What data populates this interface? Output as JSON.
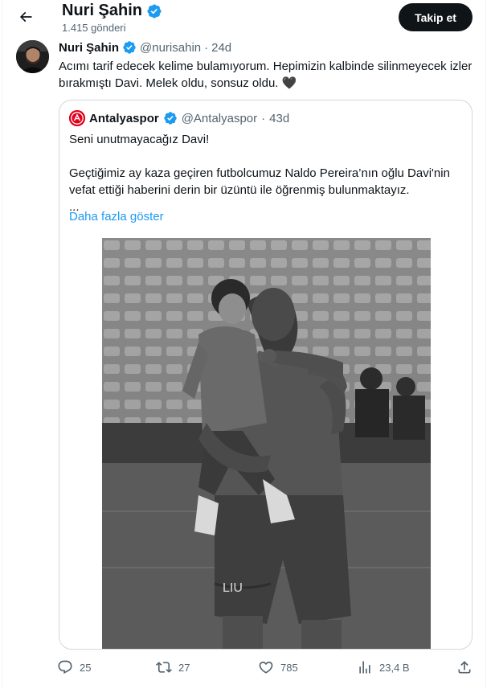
{
  "header": {
    "title": "Nuri Şahin",
    "subtitle": "1.415 gönderi",
    "follow_label": "Takip et"
  },
  "tweet": {
    "name": "Nuri Şahin",
    "handle": "@nurisahin",
    "dot": "·",
    "time": "24d",
    "text": "Acımı tarif edecek kelime bulamıyorum. Hepimizin kalbinde silinmeyecek izler bırakmıştı Davi. Melek oldu, sonsuz oldu. 🖤",
    "quote": {
      "name": "Antalyaspor",
      "handle": "@Antalyaspor",
      "dot": "·",
      "time": "43d",
      "line1": "Seni unutmayacağız Davi!",
      "line2": "Geçtiğimiz ay kaza geçiren futbolcumuz Naldo Pereira’nın oğlu Davi'nin vefat ettiği haberini derin bir üzüntü ile öğrenmiş bulunmaktayız.",
      "ellipsis": "...",
      "more_label": "Daha fazla göster"
    }
  },
  "actions": {
    "replies": "25",
    "retweets": "27",
    "likes": "785",
    "views": "23,4 B"
  },
  "colors": {
    "accent": "#1d9bf0",
    "verified": "#1d9bf0",
    "club_red": "#e2001a",
    "text_primary": "#0f1419",
    "text_secondary": "#536471",
    "border": "#cfd9de"
  },
  "icons": [
    "back-arrow-icon",
    "verified-badge-icon",
    "reply-icon",
    "retweet-icon",
    "like-icon",
    "views-icon",
    "share-icon"
  ]
}
